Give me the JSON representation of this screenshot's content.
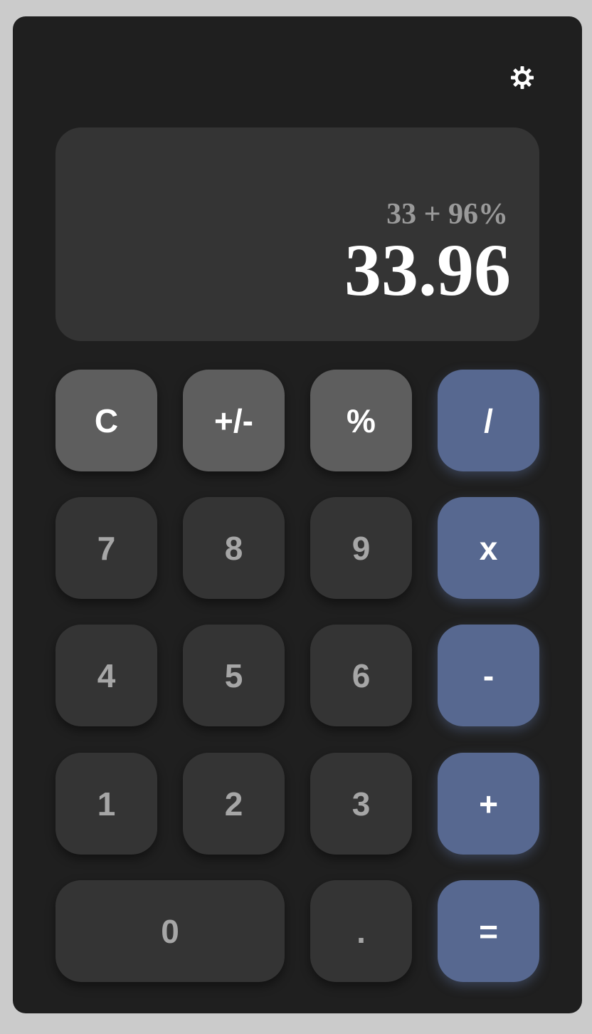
{
  "settings": {
    "icon": "gear-icon"
  },
  "display": {
    "expression": "33 + 96%",
    "result": "33.96"
  },
  "keys": {
    "clear": "C",
    "negate": "+/-",
    "percent": "%",
    "divide": "/",
    "seven": "7",
    "eight": "8",
    "nine": "9",
    "multiply": "x",
    "four": "4",
    "five": "5",
    "six": "6",
    "subtract": "-",
    "one": "1",
    "two": "2",
    "three": "3",
    "add": "+",
    "zero": "0",
    "decimal": ".",
    "equals": "="
  },
  "colors": {
    "background": "#cbcbcb",
    "body": "#1f1f1f",
    "display": "#343434",
    "number_key": "#343434",
    "function_key": "#5e5e5e",
    "operator_key": "#576890"
  }
}
